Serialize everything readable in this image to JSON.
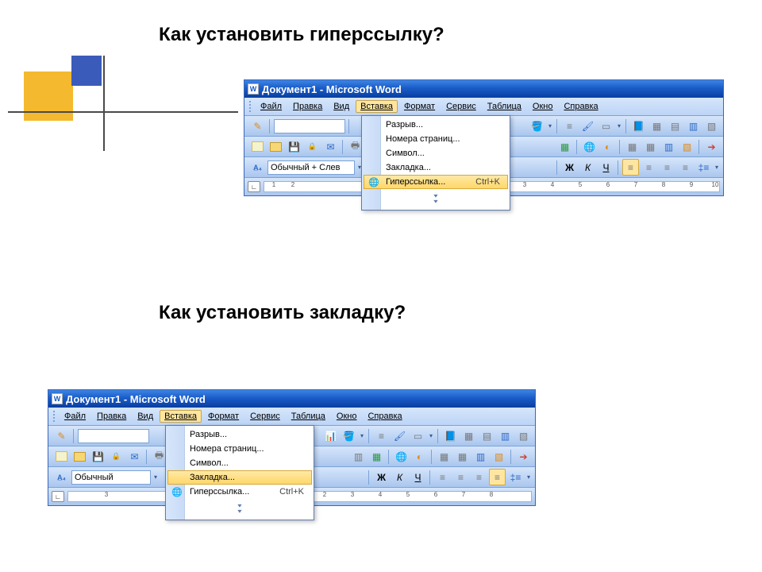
{
  "heading1": "Как установить гиперссылку?",
  "heading2": "Как установить закладку?",
  "windowTitle": "Документ1 - Microsoft Word",
  "menus": {
    "file": "Файл",
    "edit": "Правка",
    "view": "Вид",
    "insert": "Вставка",
    "format": "Формат",
    "tools": "Сервис",
    "table": "Таблица",
    "window": "Окно",
    "help": "Справка"
  },
  "dd": {
    "break": "Разрыв...",
    "pageNumbers": "Номера страниц...",
    "symbol": "Символ...",
    "bookmark": "Закладка...",
    "hyperlink": "Гиперссылка...",
    "hyperlinkShortcut": "Ctrl+K"
  },
  "style1": "Обычный + Слев",
  "style2": "Обычный",
  "rulerNumbers": [
    "1",
    "2",
    "3",
    "1",
    "2",
    "3",
    "4",
    "5",
    "6",
    "7",
    "8",
    "9",
    "10"
  ],
  "ruler2Head": "3",
  "bold": "Ж",
  "italic": "К",
  "under": "Ч"
}
